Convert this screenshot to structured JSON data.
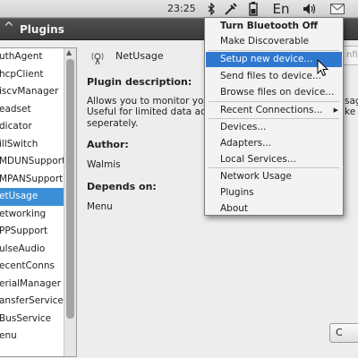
{
  "panel": {
    "clock": "23:25",
    "keyboard_layout": "En"
  },
  "window": {
    "title": "Plugins"
  },
  "plugins": {
    "items": [
      "uthAgent",
      "hcpClient",
      "iscvManager",
      "eadset",
      "dicator",
      "illSwitch",
      "MDUNSupport",
      "MPANSupport",
      "etUsage",
      "etworking",
      "PPSupport",
      "ulseAudio",
      "ecentConns",
      "erialManager",
      "ansferService",
      "BusService",
      "enu"
    ],
    "selected_index": 8
  },
  "details": {
    "plugin_name": "NetUsage",
    "configure_label": "nfig",
    "description_heading": "Plugin description:",
    "description_lines": [
      "Allows you to monitor your (r",
      "Useful for limited data access",
      "seperately."
    ],
    "description_right_fragments": [
      "sag",
      "ke"
    ],
    "author_heading": "Author:",
    "author": "Walmis",
    "depends_heading": "Depends on:",
    "depends": "Menu",
    "close_label": "C"
  },
  "menu": {
    "items": [
      {
        "label": "Turn Bluetooth Off",
        "bold": true
      },
      {
        "label": "Make Discoverable"
      },
      {
        "label": "Setup new device...",
        "highlighted": true
      },
      {
        "label": "Send files to device..."
      },
      {
        "label": "Browse files on device..."
      },
      {
        "label": "Recent Connections...",
        "submenu": true
      },
      {
        "label": "Devices..."
      },
      {
        "label": "Adapters..."
      },
      {
        "label": "Local Services..."
      },
      {
        "label": "Network Usage"
      },
      {
        "label": "Plugins"
      },
      {
        "label": "About"
      }
    ]
  },
  "colors": {
    "selection": "#3c8fd6",
    "menu_highlight": "#2f78d0",
    "title_bar": "#444444"
  }
}
